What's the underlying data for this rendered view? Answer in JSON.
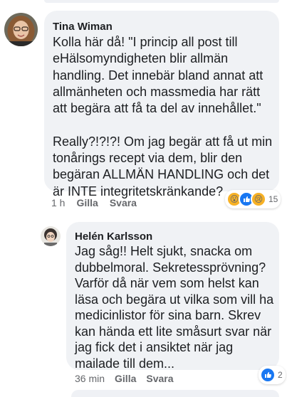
{
  "comments": [
    {
      "author": "Tina Wiman",
      "text": "Kolla här då! \"I princip all post till\neHälsomyndigheten blir allmän\nhandling. Det innebär bland annat att\nallmänheten och massmedia har rätt\natt begära att få ta del av innehållet.\"\n\nReally?!?!?! Om jag begär att få ut min\ntonårings recept via dem, blir den\nbegäran ALLMÄN HANDLING och det\när INTE integritetskränkande?",
      "time": "1 h",
      "like_label": "Gilla",
      "reply_label": "Svara",
      "reactions": [
        "wow-icon",
        "like-icon",
        "sad-icon"
      ],
      "reaction_count": "15"
    },
    {
      "author": "Helén Karlsson",
      "text": "Jag såg!! Helt sjukt, snacka om\ndubbelmoral. Sekretessprövning?\nVarför då när vem som helst kan\nläsa och begära ut vilka som vill ha\nmedicinlistor för sina barn. Skrev\nkan hända ett lite småsurt svar när\njag fick det i ansiktet när jag\nmailade till dem...",
      "time": "36 min",
      "like_label": "Gilla",
      "reply_label": "Svara",
      "reactions": [
        "like-icon"
      ],
      "reaction_count": "2"
    }
  ],
  "colors": {
    "bubble": "#f0f2f5",
    "meta_text": "#65676b",
    "like_blue": "#1877f2",
    "emoji_yellow": "#f7b125"
  }
}
